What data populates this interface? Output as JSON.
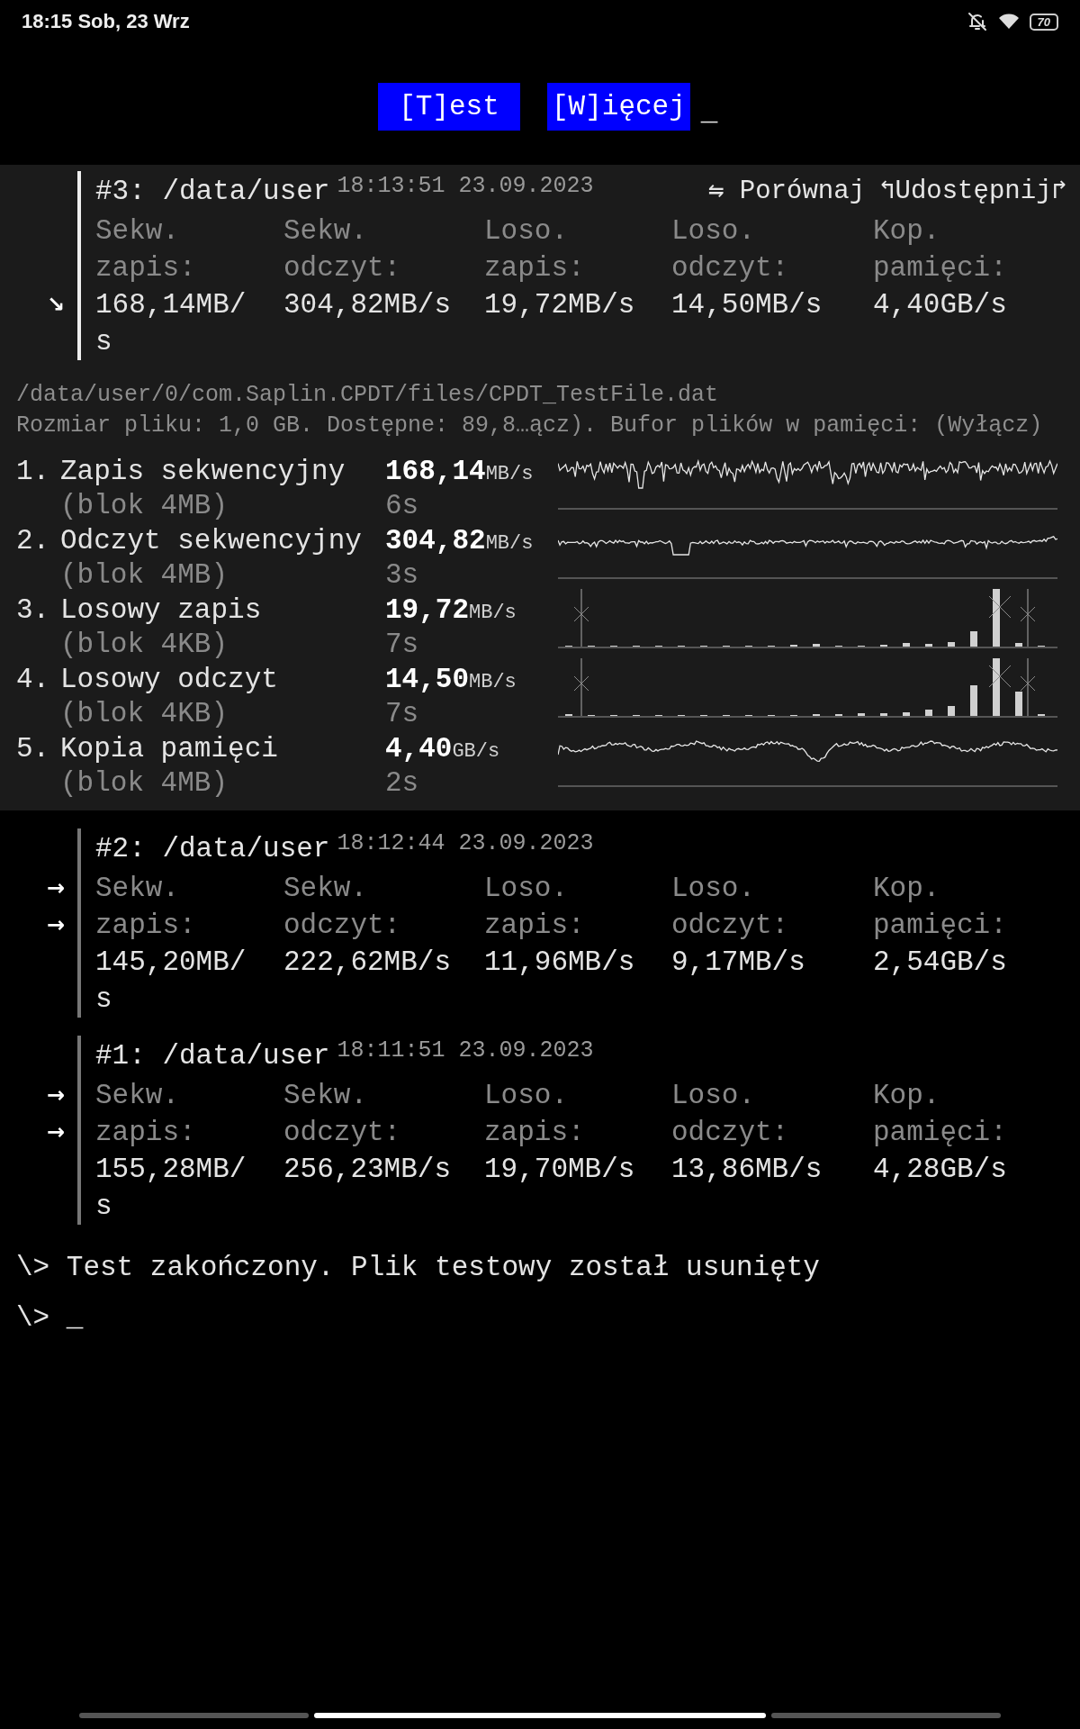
{
  "status_bar": {
    "time": "18:15 Sob, 23 Wrz",
    "battery": "70"
  },
  "toolbar": {
    "buttons": [
      "[T]est",
      "[W]ięcej"
    ],
    "cursor": "_"
  },
  "results": [
    {
      "title": "#3: /data/user",
      "timestamp": "18:13:51 23.09.2023",
      "selected": true,
      "markers": [
        "↘"
      ],
      "actions": [
        "⇋ Porównaj",
        "↰Udostępnij↱"
      ],
      "metrics": [
        {
          "label": "Sekw. zapis:",
          "value": "168,14MB/s"
        },
        {
          "label": "Sekw. odczyt:",
          "value": "304,82MB/s"
        },
        {
          "label": "Loso. zapis:",
          "value": "19,72MB/s"
        },
        {
          "label": "Loso. odczyt:",
          "value": "14,50MB/s"
        },
        {
          "label": "Kop. pamięci:",
          "value": "4,40GB/s"
        }
      ],
      "details": {
        "path": "/data/user/0/com.Saplin.CPDT/files/CPDT_TestFile.dat",
        "info": "Rozmiar pliku: 1,0 GB. Dostępne: 89,8…ącz). Bufor plików w pamięci: (Wyłącz)",
        "tests": [
          {
            "number": "1.",
            "name": "Zapis sekwencyjny",
            "block": "(blok 4MB)",
            "value": "168,14",
            "unit": "MB/s",
            "duration": "6s",
            "kind": "line"
          },
          {
            "number": "2.",
            "name": "Odczyt sekwencyjny",
            "block": "(blok 4MB)",
            "value": "304,82",
            "unit": "MB/s",
            "duration": "3s",
            "kind": "line"
          },
          {
            "number": "3.",
            "name": "Losowy zapis",
            "block": "(blok 4KB)",
            "value": "19,72",
            "unit": "MB/s",
            "duration": "7s",
            "kind": "bars"
          },
          {
            "number": "4.",
            "name": "Losowy odczyt",
            "block": "(blok 4KB)",
            "value": "14,50",
            "unit": "MB/s",
            "duration": "7s",
            "kind": "bars"
          },
          {
            "number": "5.",
            "name": "Kopia pamięci",
            "block": "(blok 4MB)",
            "value": "4,40",
            "unit": "GB/s",
            "duration": "2s",
            "kind": "line"
          }
        ]
      }
    },
    {
      "title": "#2: /data/user",
      "timestamp": "18:12:44 23.09.2023",
      "selected": false,
      "markers": [
        "→",
        "→"
      ],
      "metrics": [
        {
          "label": "Sekw. zapis:",
          "value": "145,20MB/s"
        },
        {
          "label": "Sekw. odczyt:",
          "value": "222,62MB/s"
        },
        {
          "label": "Loso. zapis:",
          "value": "11,96MB/s"
        },
        {
          "label": "Loso. odczyt:",
          "value": "9,17MB/s"
        },
        {
          "label": "Kop. pamięci:",
          "value": "2,54GB/s"
        }
      ]
    },
    {
      "title": "#1: /data/user",
      "timestamp": "18:11:51 23.09.2023",
      "selected": false,
      "markers": [
        "→",
        "→"
      ],
      "metrics": [
        {
          "label": "Sekw. zapis:",
          "value": "155,28MB/s"
        },
        {
          "label": "Sekw. odczyt:",
          "value": "256,23MB/s"
        },
        {
          "label": "Loso. zapis:",
          "value": "19,70MB/s"
        },
        {
          "label": "Loso. odczyt:",
          "value": "13,86MB/s"
        },
        {
          "label": "Kop. pamięci:",
          "value": "4,28GB/s"
        }
      ]
    }
  ],
  "console": [
    "\\> Test zakończony. Plik testowy został usunięty",
    "\\> _"
  ]
}
